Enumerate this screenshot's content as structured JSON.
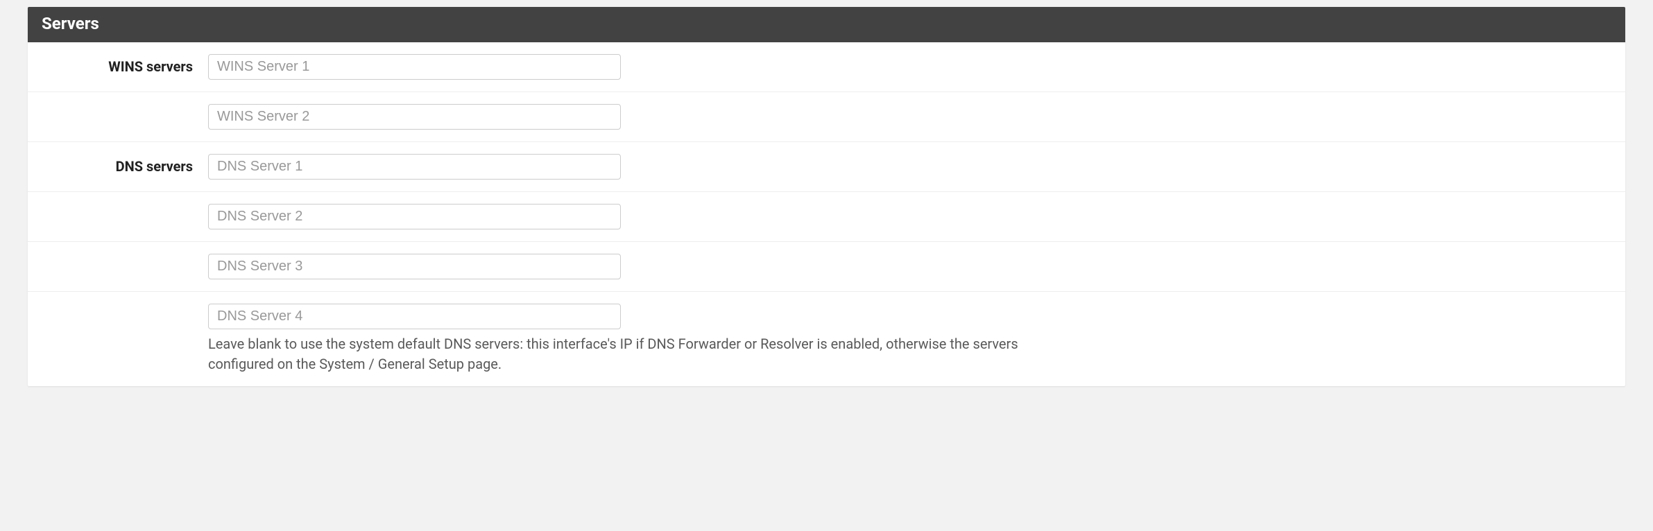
{
  "panel": {
    "title": "Servers",
    "wins": {
      "label": "WINS servers",
      "server1_placeholder": "WINS Server 1",
      "server1_value": "",
      "server2_placeholder": "WINS Server 2",
      "server2_value": ""
    },
    "dns": {
      "label": "DNS servers",
      "server1_placeholder": "DNS Server 1",
      "server1_value": "",
      "server2_placeholder": "DNS Server 2",
      "server2_value": "",
      "server3_placeholder": "DNS Server 3",
      "server3_value": "",
      "server4_placeholder": "DNS Server 4",
      "server4_value": "",
      "help_text": "Leave blank to use the system default DNS servers: this interface's IP if DNS Forwarder or Resolver is enabled, otherwise the servers configured on the System / General Setup page."
    }
  }
}
